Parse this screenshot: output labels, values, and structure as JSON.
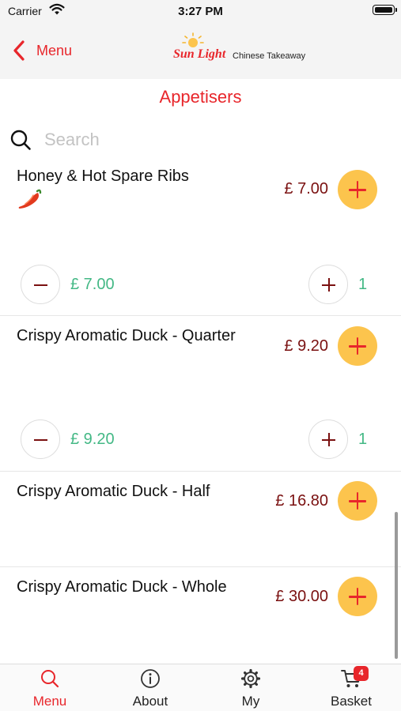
{
  "status_bar": {
    "carrier": "Carrier",
    "time": "3:27 PM"
  },
  "nav": {
    "back_label": "Menu",
    "logo": {
      "script": "Sun Light",
      "subtitle": "Chinese Takeaway"
    }
  },
  "section": {
    "title": "Appetisers"
  },
  "search": {
    "placeholder": "Search",
    "value": ""
  },
  "items": [
    {
      "name": "Honey & Hot Spare Ribs",
      "price": "£ 7.00",
      "spicy": true,
      "qty_total": "£ 7.00",
      "qty": "1"
    },
    {
      "name": "Crispy Aromatic Duck - Quarter",
      "price": "£ 9.20",
      "spicy": false,
      "qty_total": "£ 9.20",
      "qty": "1"
    },
    {
      "name": "Crispy Aromatic Duck - Half",
      "price": "£ 16.80",
      "spicy": false
    },
    {
      "name": "Crispy Aromatic Duck - Whole",
      "price": "£ 30.00",
      "spicy": false
    }
  ],
  "tabs": [
    {
      "label": "Menu",
      "icon": "search-icon",
      "active": true
    },
    {
      "label": "About",
      "icon": "info-icon",
      "active": false
    },
    {
      "label": "My",
      "icon": "gear-icon",
      "active": false
    },
    {
      "label": "Basket",
      "icon": "cart-icon",
      "active": false,
      "badge": "4"
    }
  ],
  "colors": {
    "accent": "#e8262b",
    "add_button": "#fcc44d",
    "price": "#7a1010",
    "quantity": "#43b885"
  }
}
